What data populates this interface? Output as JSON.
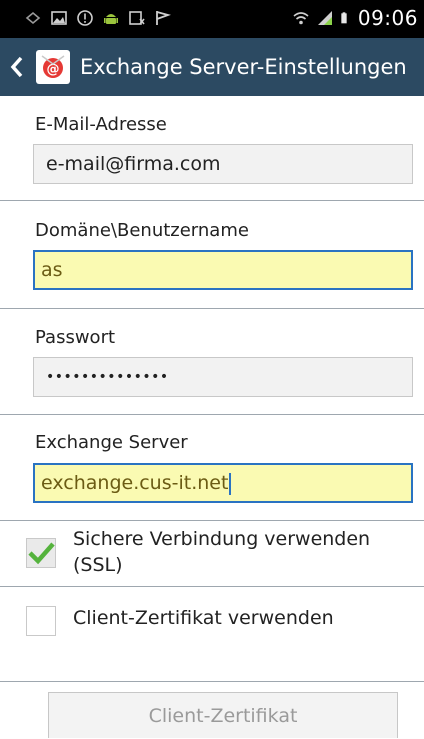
{
  "status_bar": {
    "time": "09:06",
    "icons_left": [
      "signal-off-icon",
      "image-icon",
      "alert-icon",
      "android-icon",
      "screen-record-icon",
      "flag-icon"
    ],
    "icons_right": [
      "wifi-icon",
      "cell-signal-icon",
      "battery-icon"
    ]
  },
  "action_bar": {
    "title": "Exchange Server-Einstellungen",
    "accent_color": "#2c4a62"
  },
  "form": {
    "email": {
      "label": "E-Mail-Adresse",
      "value": "e-mail@firma.com"
    },
    "domain_user": {
      "label": "Domäne\\Benutzername",
      "value": "as"
    },
    "password": {
      "label": "Passwort",
      "value": "••••••••••••••"
    },
    "server": {
      "label": "Exchange Server",
      "value": "exchange.cus-it.net"
    },
    "ssl": {
      "label_line1": "Sichere Verbindung verwenden",
      "label_line2": "(SSL)",
      "checked": true
    },
    "client_cert": {
      "label": "Client-Zertifikat verwenden",
      "checked": false
    }
  },
  "bottom_button": {
    "label": "Client-Zertifikat"
  }
}
